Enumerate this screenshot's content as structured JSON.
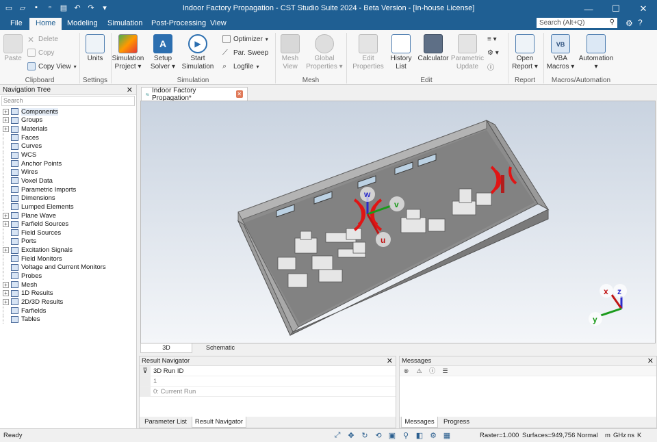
{
  "window": {
    "title": "Indoor Factory Propagation - CST Studio Suite 2024 - Beta Version - [In-house License]",
    "controls": [
      "minimize",
      "maximize",
      "close"
    ]
  },
  "menu": {
    "tabs": [
      "File",
      "Home",
      "Modeling",
      "Simulation",
      "Post-Processing",
      "View"
    ],
    "active": "Home",
    "search_placeholder": "Search (Alt+Q)"
  },
  "ribbon": {
    "clipboard": {
      "paste": "Paste",
      "delete": "Delete",
      "copy": "Copy",
      "copy_view": "Copy View",
      "group": "Clipboard"
    },
    "settings": {
      "units": "Units",
      "group": "Settings"
    },
    "simulation": {
      "sim_project_1": "Simulation",
      "sim_project_2": "Project",
      "setup_solver_1": "Setup",
      "setup_solver_2": "Solver",
      "start_sim_1": "Start",
      "start_sim_2": "Simulation",
      "optimizer": "Optimizer",
      "par_sweep": "Par. Sweep",
      "logfile": "Logfile",
      "group": "Simulation"
    },
    "mesh": {
      "mesh_view_1": "Mesh",
      "mesh_view_2": "View",
      "global_props_1": "Global",
      "global_props_2": "Properties",
      "group": "Mesh"
    },
    "edit": {
      "edit_props_1": "Edit",
      "edit_props_2": "Properties",
      "history_1": "History",
      "history_2": "List",
      "calculator": "Calculator",
      "param_update_1": "Parametric",
      "param_update_2": "Update",
      "group": "Edit"
    },
    "report": {
      "open_report_1": "Open",
      "open_report_2": "Report",
      "group": "Report"
    },
    "macros": {
      "vba_1": "VBA",
      "vba_2": "Macros",
      "automation": "Automation",
      "group": "Macros/Automation"
    }
  },
  "nav_tree": {
    "title": "Navigation Tree",
    "search_placeholder": "Search",
    "items": [
      {
        "label": "Components",
        "expandable": true
      },
      {
        "label": "Groups",
        "expandable": true
      },
      {
        "label": "Materials",
        "expandable": true
      },
      {
        "label": "Faces",
        "expandable": false
      },
      {
        "label": "Curves",
        "expandable": false
      },
      {
        "label": "WCS",
        "expandable": false
      },
      {
        "label": "Anchor Points",
        "expandable": false
      },
      {
        "label": "Wires",
        "expandable": false
      },
      {
        "label": "Voxel Data",
        "expandable": false
      },
      {
        "label": "Parametric Imports",
        "expandable": false
      },
      {
        "label": "Dimensions",
        "expandable": false
      },
      {
        "label": "Lumped Elements",
        "expandable": false
      },
      {
        "label": "Plane Wave",
        "expandable": true
      },
      {
        "label": "Farfield Sources",
        "expandable": true
      },
      {
        "label": "Field Sources",
        "expandable": false
      },
      {
        "label": "Ports",
        "expandable": false
      },
      {
        "label": "Excitation Signals",
        "expandable": true
      },
      {
        "label": "Field Monitors",
        "expandable": false
      },
      {
        "label": "Voltage and Current Monitors",
        "expandable": false
      },
      {
        "label": "Probes",
        "expandable": false
      },
      {
        "label": "Mesh",
        "expandable": true
      },
      {
        "label": "1D Results",
        "expandable": true
      },
      {
        "label": "2D/3D Results",
        "expandable": true
      },
      {
        "label": "Farfields",
        "expandable": false
      },
      {
        "label": "Tables",
        "expandable": false
      }
    ]
  },
  "document": {
    "tab_label": "Indoor Factory Propagation*",
    "view_tabs": [
      "3D",
      "Schematic"
    ],
    "axis_labels": {
      "u": "u",
      "v": "v",
      "w": "w",
      "x": "x",
      "y": "y",
      "z": "z"
    }
  },
  "result_navigator": {
    "title": "Result Navigator",
    "header": "3D Run ID",
    "rows": [
      "1",
      "0: Current Run"
    ],
    "tabs": [
      "Parameter List",
      "Result Navigator"
    ]
  },
  "messages": {
    "title": "Messages",
    "tabs": [
      "Messages",
      "Progress"
    ]
  },
  "status": {
    "ready": "Ready",
    "raster": "Raster=1.000",
    "surfaces": "Surfaces=949,756",
    "mode": "Normal",
    "units": [
      "m",
      "GHz",
      "ns",
      "K"
    ]
  }
}
